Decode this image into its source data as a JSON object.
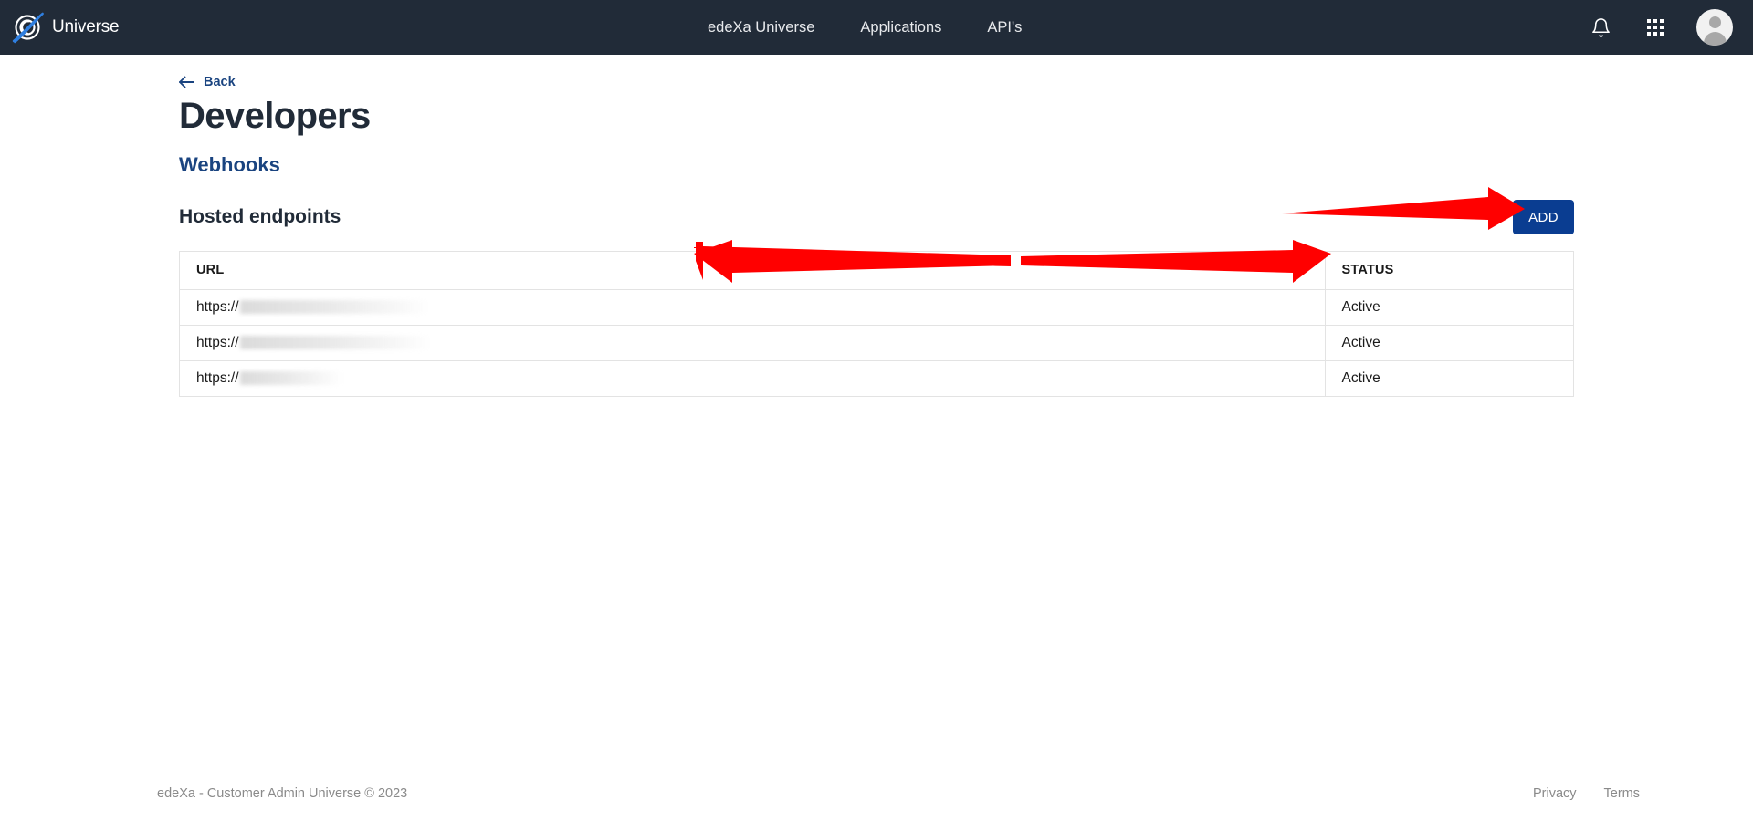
{
  "header": {
    "brand": {
      "name": "Universe",
      "icon": "universe-logo-icon"
    },
    "nav_links": [
      {
        "label": "edeXa Universe"
      },
      {
        "label": "Applications"
      },
      {
        "label": "API's"
      }
    ],
    "actions": {
      "notifications_icon": "bell-icon",
      "apps_icon": "apps-grid-icon",
      "avatar_icon": "user-avatar-icon"
    }
  },
  "main": {
    "back_label": "Back",
    "back_icon": "arrow-left-icon",
    "page_title": "Developers",
    "section_link": "Webhooks",
    "subheading": "Hosted endpoints",
    "add_button_label": "ADD",
    "table": {
      "columns": [
        "URL",
        "STATUS"
      ],
      "rows": [
        {
          "url_prefix": "https://",
          "url_redacted_width": 205,
          "status": "Active"
        },
        {
          "url_prefix": "https://",
          "url_redacted_width": 207,
          "status": "Active"
        },
        {
          "url_prefix": "https://",
          "url_redacted_width": 110,
          "status": "Active"
        }
      ]
    }
  },
  "annotations": {
    "arrow_color": "#FF0000",
    "arrows": [
      {
        "name": "arrow-pointing-to-add-button",
        "direction": "right"
      },
      {
        "name": "double-arrow-across-url-column",
        "direction": "both"
      }
    ]
  },
  "footer": {
    "copyright": "edeXa - Customer Admin Universe © 2023",
    "links": [
      {
        "label": "Privacy"
      },
      {
        "label": "Terms"
      }
    ]
  },
  "theme": {
    "nav_background": "#212B38",
    "accent_blue": "#0A3D91",
    "link_blue": "#1A4480",
    "border_grey": "#E3E3E3",
    "muted_text": "#8A8A8A"
  }
}
